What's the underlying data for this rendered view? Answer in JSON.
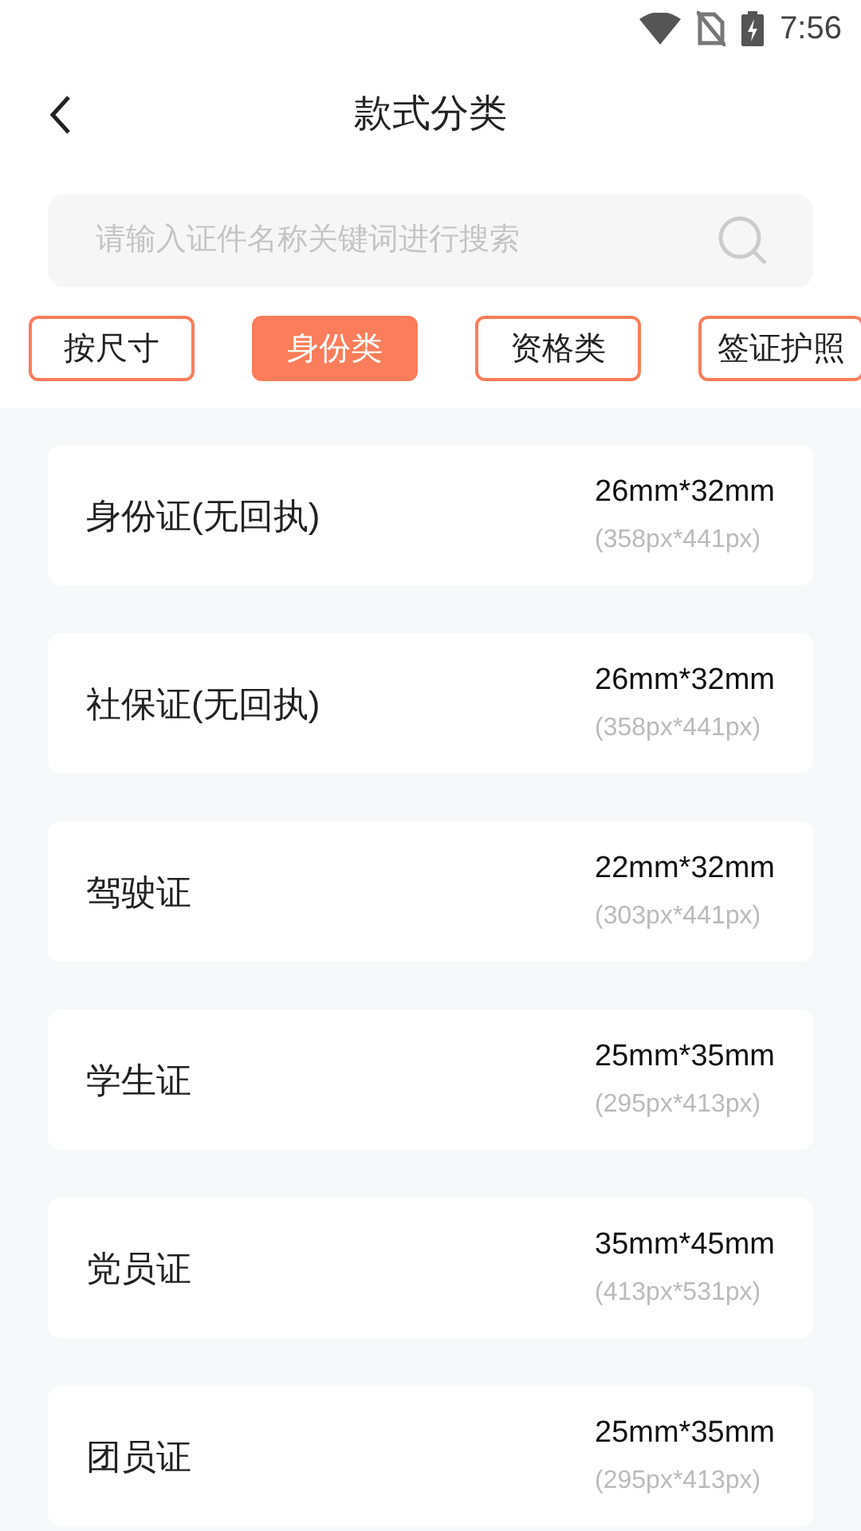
{
  "status_bar": {
    "time": "7:56"
  },
  "header": {
    "title": "款式分类"
  },
  "search": {
    "placeholder": "请输入证件名称关键词进行搜索"
  },
  "tabs": [
    {
      "label": "按尺寸",
      "selected": false
    },
    {
      "label": "身份类",
      "selected": true
    },
    {
      "label": "资格类",
      "selected": false
    },
    {
      "label": "签证护照",
      "selected": false
    }
  ],
  "items": [
    {
      "name": "身份证(无回执)",
      "size": "26mm*32mm",
      "pixels": "(358px*441px)"
    },
    {
      "name": "社保证(无回执)",
      "size": "26mm*32mm",
      "pixels": "(358px*441px)"
    },
    {
      "name": "驾驶证",
      "size": "22mm*32mm",
      "pixels": "(303px*441px)"
    },
    {
      "name": "学生证",
      "size": "25mm*35mm",
      "pixels": "(295px*413px)"
    },
    {
      "name": "党员证",
      "size": "35mm*45mm",
      "pixels": "(413px*531px)"
    },
    {
      "name": "团员证",
      "size": "25mm*35mm",
      "pixels": "(295px*413px)"
    }
  ]
}
